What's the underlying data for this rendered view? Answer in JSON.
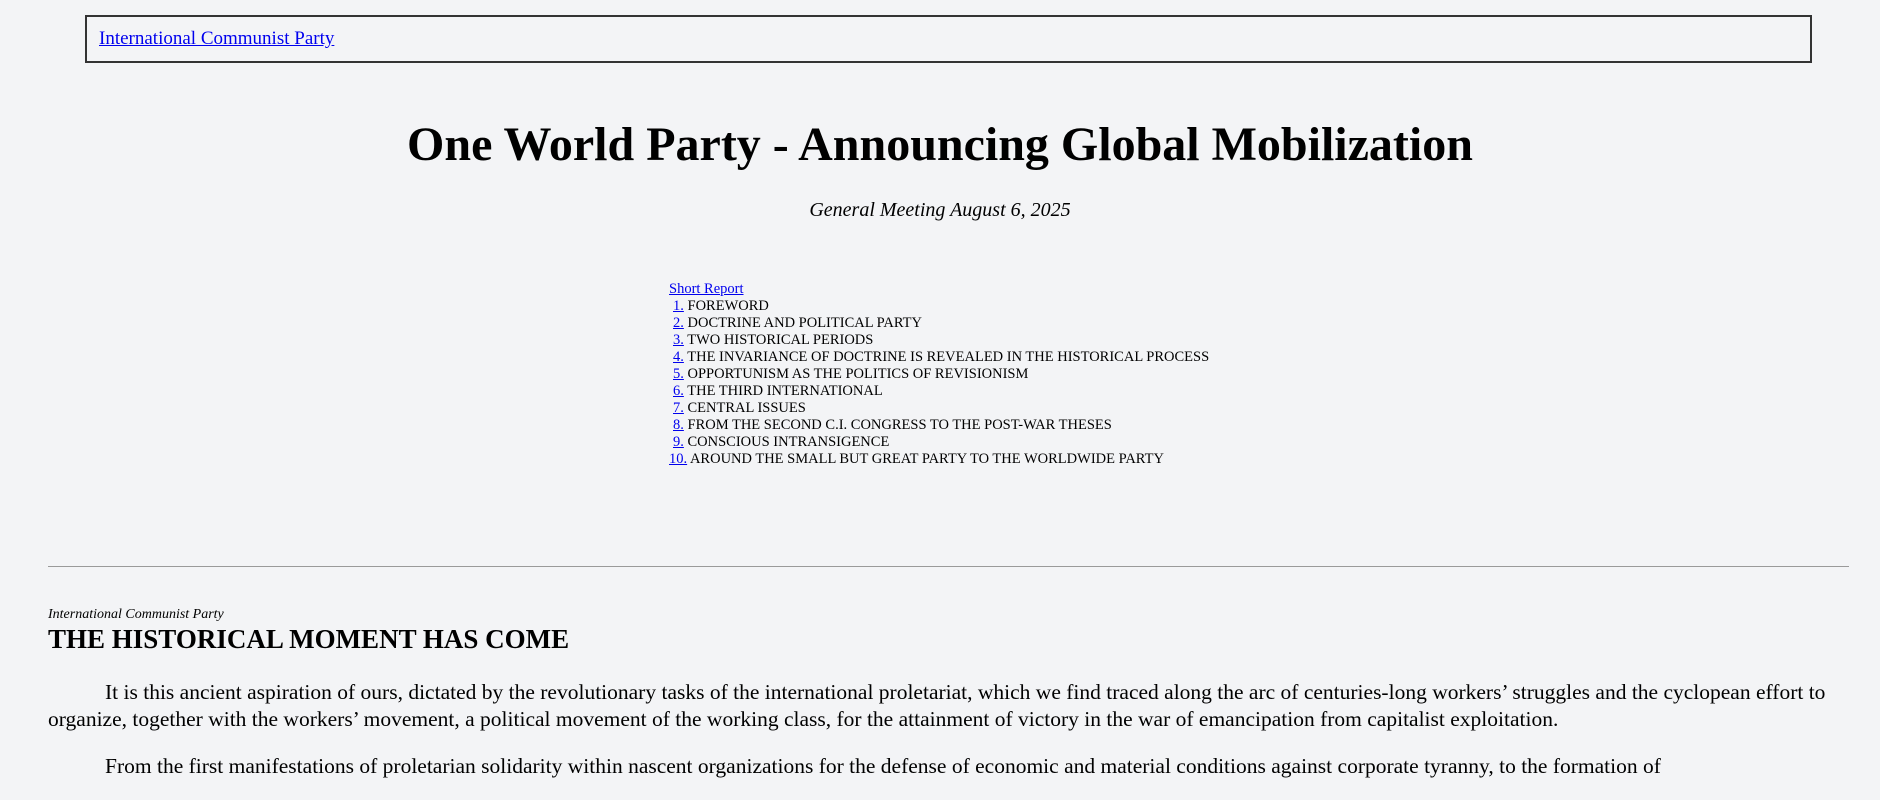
{
  "header": {
    "site_link": "International Communist Party"
  },
  "article": {
    "title": "One World Party - Announcing Global Mobilization",
    "subtitle": "General Meeting August 6, 2025"
  },
  "toc": {
    "heading_link": "Short Report",
    "items": [
      {
        "num": "1.",
        "label": "FOREWORD"
      },
      {
        "num": "2.",
        "label": "DOCTRINE AND POLITICAL PARTY"
      },
      {
        "num": "3.",
        "label": "TWO HISTORICAL PERIODS"
      },
      {
        "num": "4.",
        "label": "THE INVARIANCE OF DOCTRINE IS REVEALED IN THE HISTORICAL PROCESS"
      },
      {
        "num": "5.",
        "label": "OPPORTUNISM AS THE POLITICS OF REVISIONISM"
      },
      {
        "num": "6.",
        "label": "THE THIRD INTERNATIONAL"
      },
      {
        "num": "7.",
        "label": "CENTRAL ISSUES"
      },
      {
        "num": "8.",
        "label": "FROM THE SECOND C.I. CONGRESS TO THE POST-WAR THESES"
      },
      {
        "num": "9.",
        "label": "CONSCIOUS INTRANSIGENCE"
      },
      {
        "num": "10.",
        "label": "AROUND THE SMALL BUT GREAT PARTY TO THE WORLDWIDE PARTY"
      }
    ]
  },
  "section": {
    "kicker": "International Communist Party",
    "title": "THE HISTORICAL MOMENT HAS COME",
    "paragraphs": [
      "It is this ancient aspiration of ours, dictated by the revolutionary tasks of the international proletariat, which we find traced along the arc of centuries-long workers’ struggles and the cyclopean effort to organize, together with the workers’ movement, a political movement of the working class, for the attainment of victory in the war of emancipation from capitalist exploitation.",
      "From the first manifestations of proletarian solidarity within nascent organizations for the defense of economic and material conditions against corporate tyranny, to the formation of"
    ]
  }
}
